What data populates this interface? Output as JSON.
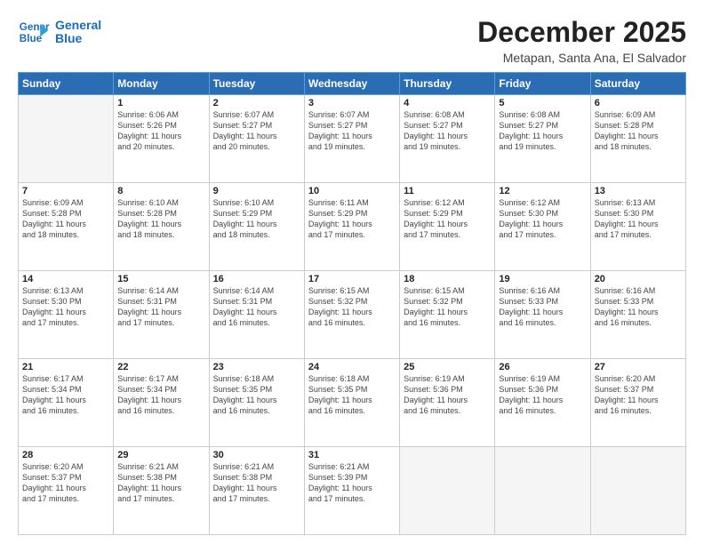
{
  "logo": {
    "line1": "General",
    "line2": "Blue"
  },
  "title": "December 2025",
  "subtitle": "Metapan, Santa Ana, El Salvador",
  "header_days": [
    "Sunday",
    "Monday",
    "Tuesday",
    "Wednesday",
    "Thursday",
    "Friday",
    "Saturday"
  ],
  "weeks": [
    [
      {
        "day": "",
        "info": ""
      },
      {
        "day": "1",
        "info": "Sunrise: 6:06 AM\nSunset: 5:26 PM\nDaylight: 11 hours\nand 20 minutes."
      },
      {
        "day": "2",
        "info": "Sunrise: 6:07 AM\nSunset: 5:27 PM\nDaylight: 11 hours\nand 20 minutes."
      },
      {
        "day": "3",
        "info": "Sunrise: 6:07 AM\nSunset: 5:27 PM\nDaylight: 11 hours\nand 19 minutes."
      },
      {
        "day": "4",
        "info": "Sunrise: 6:08 AM\nSunset: 5:27 PM\nDaylight: 11 hours\nand 19 minutes."
      },
      {
        "day": "5",
        "info": "Sunrise: 6:08 AM\nSunset: 5:27 PM\nDaylight: 11 hours\nand 19 minutes."
      },
      {
        "day": "6",
        "info": "Sunrise: 6:09 AM\nSunset: 5:28 PM\nDaylight: 11 hours\nand 18 minutes."
      }
    ],
    [
      {
        "day": "7",
        "info": "Sunrise: 6:09 AM\nSunset: 5:28 PM\nDaylight: 11 hours\nand 18 minutes."
      },
      {
        "day": "8",
        "info": "Sunrise: 6:10 AM\nSunset: 5:28 PM\nDaylight: 11 hours\nand 18 minutes."
      },
      {
        "day": "9",
        "info": "Sunrise: 6:10 AM\nSunset: 5:29 PM\nDaylight: 11 hours\nand 18 minutes."
      },
      {
        "day": "10",
        "info": "Sunrise: 6:11 AM\nSunset: 5:29 PM\nDaylight: 11 hours\nand 17 minutes."
      },
      {
        "day": "11",
        "info": "Sunrise: 6:12 AM\nSunset: 5:29 PM\nDaylight: 11 hours\nand 17 minutes."
      },
      {
        "day": "12",
        "info": "Sunrise: 6:12 AM\nSunset: 5:30 PM\nDaylight: 11 hours\nand 17 minutes."
      },
      {
        "day": "13",
        "info": "Sunrise: 6:13 AM\nSunset: 5:30 PM\nDaylight: 11 hours\nand 17 minutes."
      }
    ],
    [
      {
        "day": "14",
        "info": "Sunrise: 6:13 AM\nSunset: 5:30 PM\nDaylight: 11 hours\nand 17 minutes."
      },
      {
        "day": "15",
        "info": "Sunrise: 6:14 AM\nSunset: 5:31 PM\nDaylight: 11 hours\nand 17 minutes."
      },
      {
        "day": "16",
        "info": "Sunrise: 6:14 AM\nSunset: 5:31 PM\nDaylight: 11 hours\nand 16 minutes."
      },
      {
        "day": "17",
        "info": "Sunrise: 6:15 AM\nSunset: 5:32 PM\nDaylight: 11 hours\nand 16 minutes."
      },
      {
        "day": "18",
        "info": "Sunrise: 6:15 AM\nSunset: 5:32 PM\nDaylight: 11 hours\nand 16 minutes."
      },
      {
        "day": "19",
        "info": "Sunrise: 6:16 AM\nSunset: 5:33 PM\nDaylight: 11 hours\nand 16 minutes."
      },
      {
        "day": "20",
        "info": "Sunrise: 6:16 AM\nSunset: 5:33 PM\nDaylight: 11 hours\nand 16 minutes."
      }
    ],
    [
      {
        "day": "21",
        "info": "Sunrise: 6:17 AM\nSunset: 5:34 PM\nDaylight: 11 hours\nand 16 minutes."
      },
      {
        "day": "22",
        "info": "Sunrise: 6:17 AM\nSunset: 5:34 PM\nDaylight: 11 hours\nand 16 minutes."
      },
      {
        "day": "23",
        "info": "Sunrise: 6:18 AM\nSunset: 5:35 PM\nDaylight: 11 hours\nand 16 minutes."
      },
      {
        "day": "24",
        "info": "Sunrise: 6:18 AM\nSunset: 5:35 PM\nDaylight: 11 hours\nand 16 minutes."
      },
      {
        "day": "25",
        "info": "Sunrise: 6:19 AM\nSunset: 5:36 PM\nDaylight: 11 hours\nand 16 minutes."
      },
      {
        "day": "26",
        "info": "Sunrise: 6:19 AM\nSunset: 5:36 PM\nDaylight: 11 hours\nand 16 minutes."
      },
      {
        "day": "27",
        "info": "Sunrise: 6:20 AM\nSunset: 5:37 PM\nDaylight: 11 hours\nand 16 minutes."
      }
    ],
    [
      {
        "day": "28",
        "info": "Sunrise: 6:20 AM\nSunset: 5:37 PM\nDaylight: 11 hours\nand 17 minutes."
      },
      {
        "day": "29",
        "info": "Sunrise: 6:21 AM\nSunset: 5:38 PM\nDaylight: 11 hours\nand 17 minutes."
      },
      {
        "day": "30",
        "info": "Sunrise: 6:21 AM\nSunset: 5:38 PM\nDaylight: 11 hours\nand 17 minutes."
      },
      {
        "day": "31",
        "info": "Sunrise: 6:21 AM\nSunset: 5:39 PM\nDaylight: 11 hours\nand 17 minutes."
      },
      {
        "day": "",
        "info": ""
      },
      {
        "day": "",
        "info": ""
      },
      {
        "day": "",
        "info": ""
      }
    ]
  ]
}
